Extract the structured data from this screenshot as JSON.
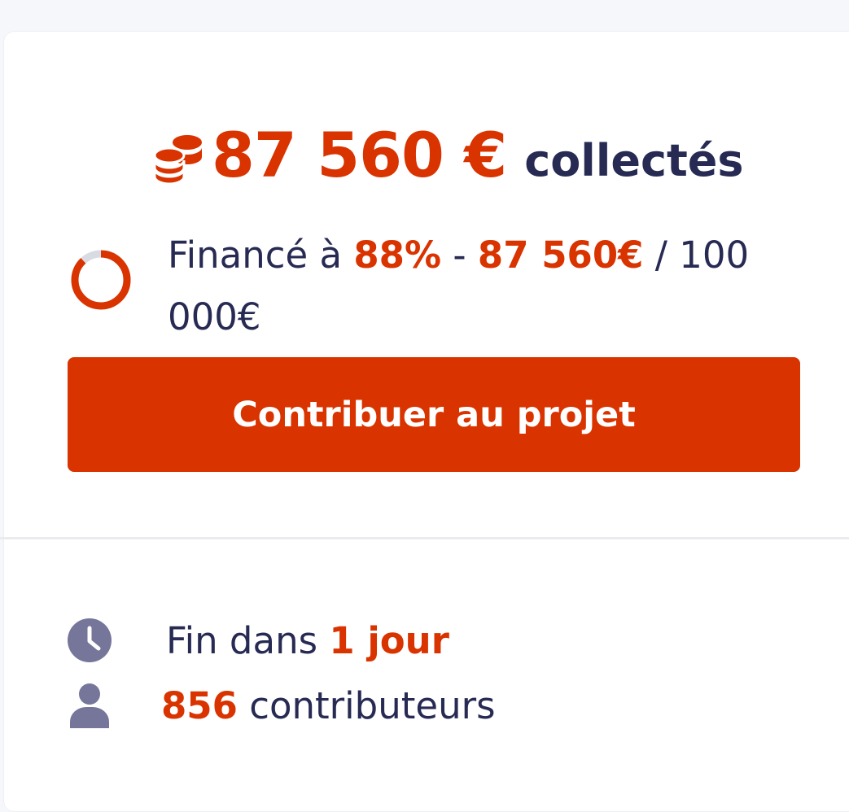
{
  "colors": {
    "accent": "#d93300",
    "text": "#272a53",
    "icon": "#75769a",
    "ring_track": "#d9dbe2",
    "background": "#f6f7fb",
    "card": "#ffffff"
  },
  "summary": {
    "amount": "87 560 €",
    "label": "collectés",
    "icon": "coins-icon"
  },
  "funding": {
    "prefix": "Financé à ",
    "percent": "88%",
    "separator": " - ",
    "raised": "87 560€",
    "goal": " / 100 000€",
    "progress": 0.88
  },
  "cta": {
    "label": "Contribuer au projet"
  },
  "stats": {
    "end": {
      "prefix": "Fin dans ",
      "value": "1 jour",
      "icon": "clock-icon"
    },
    "contributors": {
      "count": "856",
      "label": " contributeurs",
      "icon": "user-icon"
    }
  }
}
